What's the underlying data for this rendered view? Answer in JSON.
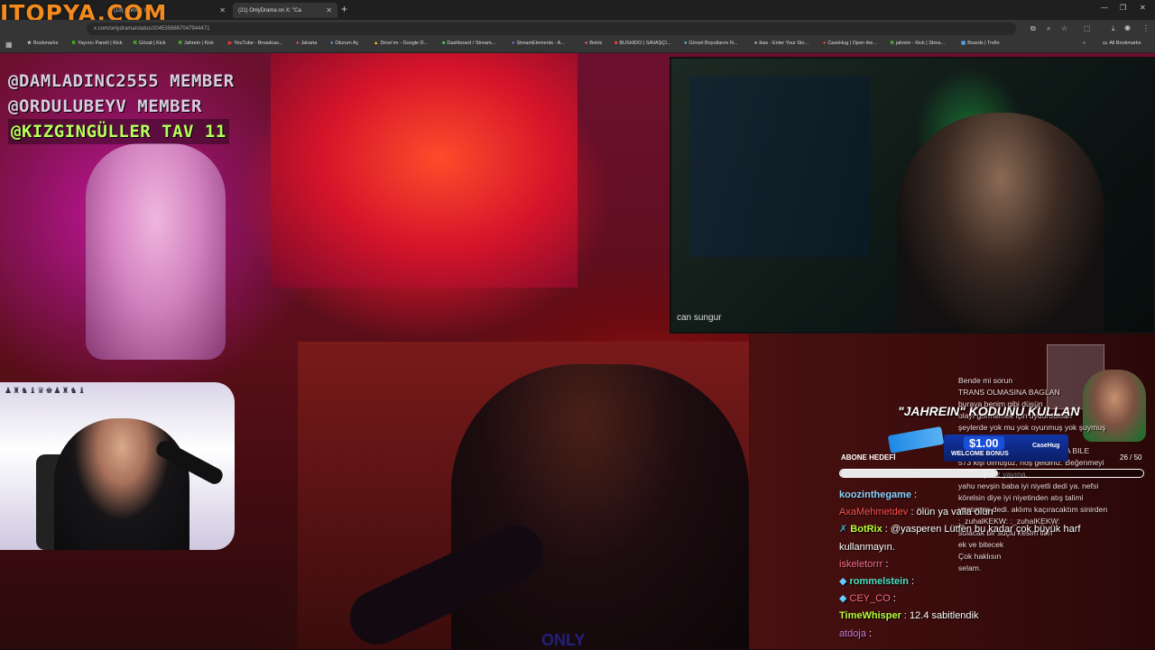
{
  "watermark": "ITOPYA.COM",
  "tabs": [
    {
      "label": "(19) Home / X",
      "active": false
    },
    {
      "label": "(21) OnlyDrama on X: \"Ca",
      "active": true
    }
  ],
  "url": "x.com/onlydrama/status/2045358867047944471",
  "bookmarks": [
    "Bookmarks",
    "Yayıncı Paneli | Kick",
    "Gözat | Kick",
    "Jahrein | Kick",
    "YouTube - Broadcas...",
    "Jaharia",
    "Oturum Aç",
    "Drive'ım - Google D...",
    "Dashboard / Stream...",
    "StreamElements - A...",
    "Botrix",
    "BUSHIDO | SAVAŞÇI...",
    "Görsel Boyutlarını N...",
    "ikas - Enter Your Sto...",
    "CaseHug | Open the...",
    "jahrein - Kick | Strea...",
    "Boards | Trello"
  ],
  "all_bookmarks": "All Bookmarks",
  "alerts": [
    "@DAMLADINC2555 MEMBER",
    "@ORDULUBEYV MEMBER",
    "@KIZGINGÜLLER TAV 11"
  ],
  "guest_name": "can sungur",
  "goal": {
    "label": "ABONE HEDEFİ",
    "current": 26,
    "target": 50,
    "count_text": "26 / 50",
    "fraction": 0.52
  },
  "promo": {
    "code_text": "\"JAHREIN\" KODUNU KULLAN",
    "amount": "$1.00",
    "bonus": "WELCOME BONUS",
    "brand": "CaseHug"
  },
  "chat": [
    {
      "user": "koozinthegame",
      "sep": " : ",
      "msg": "",
      "ucolor": "u-cyan"
    },
    {
      "user": "AxaMehmetdev",
      "sep": " : ",
      "msg": "ölün ya valla ölün",
      "ucolor": "u-red"
    },
    {
      "user": "BotRix",
      "sep": " : ",
      "msg": "@yasperen Lütfen bu kadar çok büyük harf",
      "ucolor": "u-lime"
    },
    {
      "user": "",
      "sep": "",
      "msg": "kullanmayın.",
      "ucolor": ""
    },
    {
      "user": "iskeletorrr",
      "sep": " : ",
      "msg": "",
      "ucolor": "u-pink"
    },
    {
      "user": "rommelstein",
      "sep": " : ",
      "msg": "",
      "ucolor": "u-teal"
    },
    {
      "user": "CEY_CO",
      "sep": " : ",
      "msg": "",
      "ucolor": "u-pink"
    },
    {
      "user": "TimeWhisper",
      "sep": " : ",
      "msg": "12.4 sabitlendik",
      "ucolor": "u-lime"
    },
    {
      "user": "atdoja",
      "sep": " : ",
      "msg": "",
      "ucolor": "u-mag"
    }
  ],
  "ghost_chat": [
    "Bende mi sorun",
    "TRANS OLMASINA BAGLAN",
    "",
    "buraya benim gibi düşün",
    "",
    "",
    "",
    "olayı görmemek için uydurdukları",
    "şeylerde yok mu yok oyunmuş yok şuymuş",
    "Zuhaaaill",
    "BUNU YAPTIRLAR BU OLAYDA BILE",
    "573 kişi olmuşuz, hoş geldiniz. Beğenmeyi",
    "unutmayınız yayına.",
    "yahu nevşin baba iyi niyetli dedi ya. nefsi",
    "körelsin diye iyi niyetinden atış talimi",
    "yaptırmış dedi. aklımı kaçıracaktım sinirden",
    ":_zuhalKEKW: :_zuhalKEKW:",
    "",
    "sulacak bir suçlu kesim ilan",
    "ek ve bitecek",
    "Çok haklısın",
    "selam."
  ],
  "bottom_caption": "ONLY"
}
